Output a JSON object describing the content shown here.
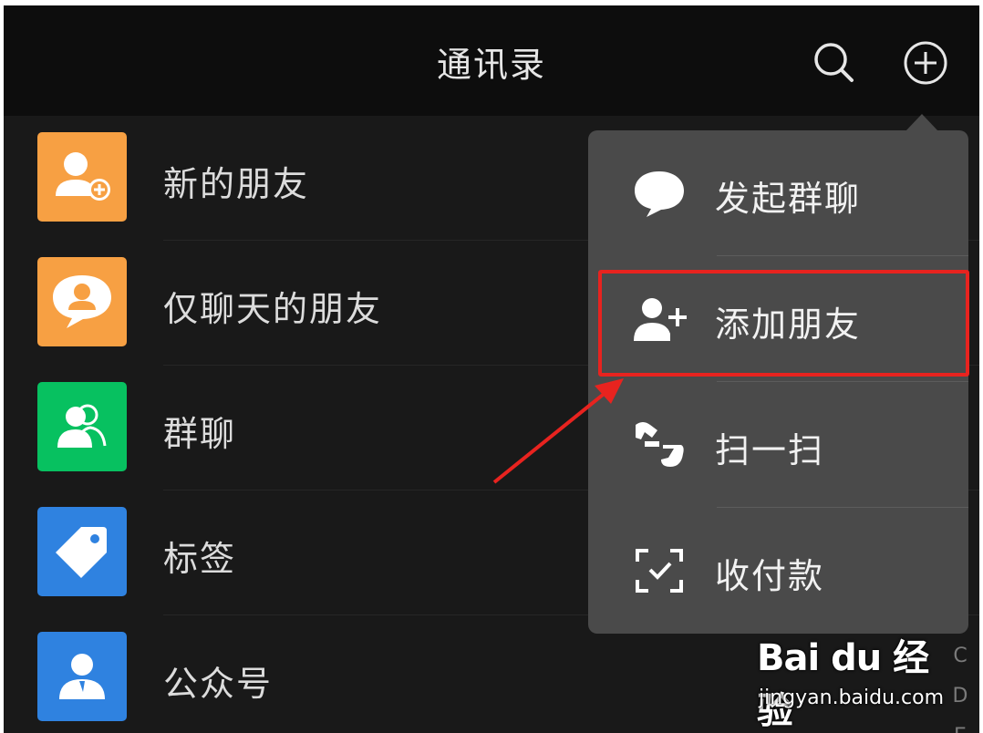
{
  "header": {
    "title": "通讯录",
    "search_icon": "search-icon",
    "add_icon": "plus-circle-icon"
  },
  "contacts_list": {
    "items": [
      {
        "label": "新的朋友",
        "icon": "add-friend-icon",
        "color": "#f7a043"
      },
      {
        "label": "仅聊天的朋友",
        "icon": "chat-person-icon",
        "color": "#f7a043"
      },
      {
        "label": "群聊",
        "icon": "group-icon",
        "color": "#07c160"
      },
      {
        "label": "标签",
        "icon": "tag-icon",
        "color": "#2f82e0"
      },
      {
        "label": "公众号",
        "icon": "official-account-icon",
        "color": "#2f82e0"
      }
    ],
    "index_letters": [
      "C",
      "D",
      "E"
    ]
  },
  "popup_menu": {
    "items": [
      {
        "label": "发起群聊",
        "icon": "chat-bubble-icon"
      },
      {
        "label": "添加朋友",
        "icon": "add-person-icon",
        "highlighted": true
      },
      {
        "label": "扫一扫",
        "icon": "scan-icon"
      },
      {
        "label": "收付款",
        "icon": "payment-qr-icon"
      }
    ],
    "background": "#4a4a4a"
  },
  "annotation": {
    "highlight_color": "#e8231f"
  },
  "watermark": {
    "logo_text": "Bai du 经验",
    "url": "jingyan.baidu.com"
  }
}
